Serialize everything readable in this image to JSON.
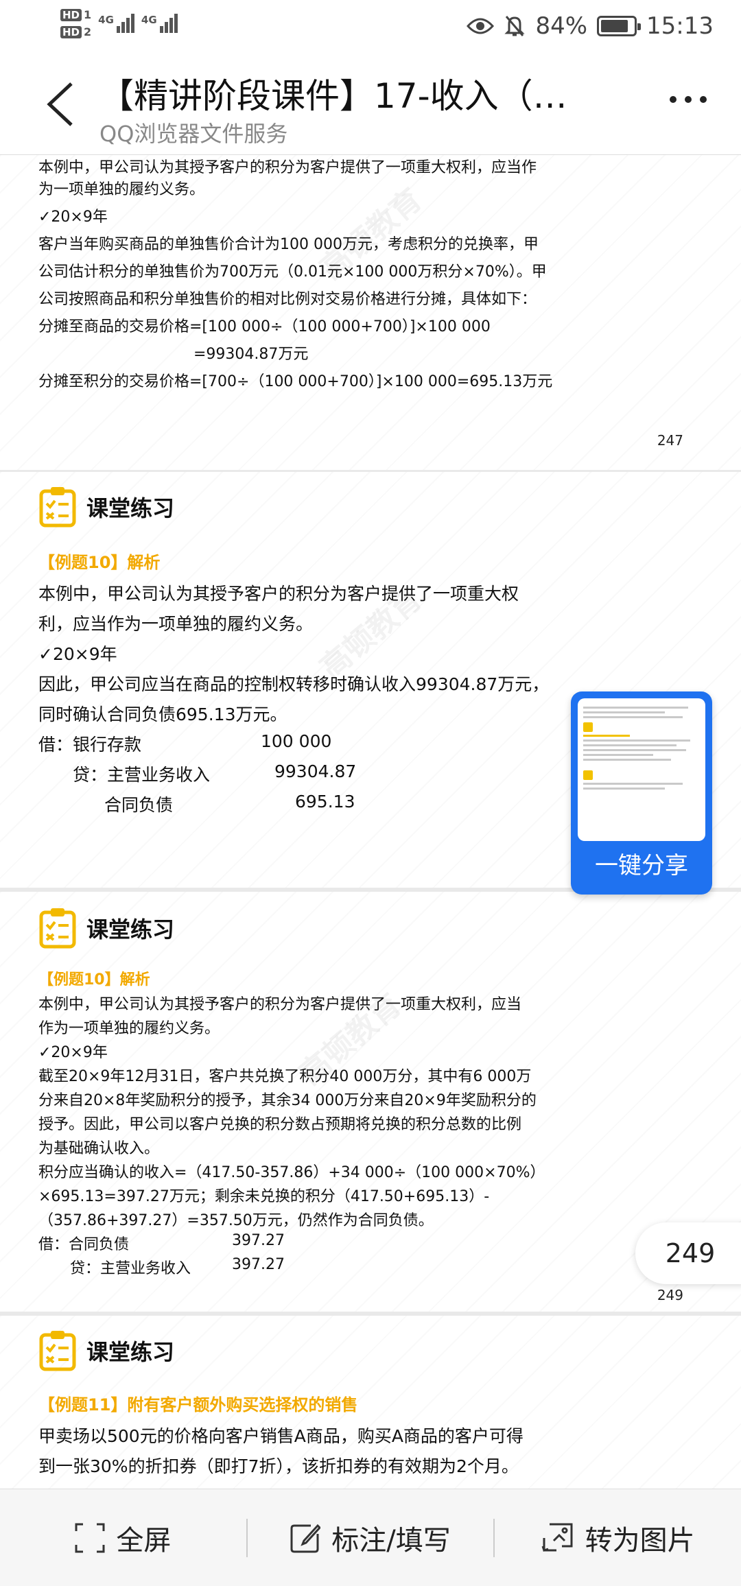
{
  "status_bar": {
    "hd1": "HD",
    "hd1_num": "1",
    "hd2": "HD",
    "hd2_num": "2",
    "net1": "4G",
    "net2": "4G",
    "battery_pct": "84%",
    "battery_level": 0.84,
    "time": "15:13"
  },
  "header": {
    "title": "【精讲阶段课件】17-收入（…",
    "subtitle": "QQ浏览器文件服务"
  },
  "pages": {
    "p247": {
      "lines": [
        "本例中，甲公司认为其授予客户的积分为客户提供了一项重大权利，应当作",
        "为一项单独的履约义务。",
        "✓20×9年",
        "客户当年购买商品的单独售价合计为100 000万元，考虑积分的兑换率，甲",
        "公司估计积分的单独售价为700万元（0.01元×100 000万积分×70%）。甲",
        "公司按照商品和积分单独售价的相对比例对交易价格进行分摊，具体如下：",
        "分摊至商品的交易价格=[100 000÷（100 000+700）]×100 000",
        "=99304.87万元",
        "分摊至积分的交易价格=[700÷（100 000+700）]×100 000=695.13万元"
      ],
      "page_number": "247"
    },
    "p248": {
      "heading": "课堂练习",
      "section": "【例题10】解析",
      "lines": [
        "本例中，甲公司认为其授予客户的积分为客户提供了一项重大权",
        "利，应当作为一项单独的履约义务。",
        "✓20×9年",
        "因此，甲公司应当在商品的控制权转移时确认收入99304.87万元，",
        "同时确认合同负债695.13万元。"
      ],
      "entries": [
        {
          "label": "借：银行存款",
          "amount": "100 000"
        },
        {
          "label": "贷：主营业务收入",
          "amount": "99304.87"
        },
        {
          "label": "合同负债",
          "amount": "695.13"
        }
      ],
      "watermark": "高顿教育"
    },
    "p249": {
      "heading": "课堂练习",
      "section": "【例题10】解析",
      "lines": [
        "本例中，甲公司认为其授予客户的积分为客户提供了一项重大权利，应当",
        "作为一项单独的履约义务。",
        "✓20×9年",
        "截至20×9年12月31日，客户共兑换了积分40 000万分，其中有6 000万",
        "分来自20×8年奖励积分的授予，其余34 000万分来自20×9年奖励积分的",
        "授予。因此，甲公司以客户兑换的积分数占预期将兑换的积分总数的比例",
        "为基础确认收入。",
        "积分应当确认的收入=（417.50-357.86）+34 000÷（100 000×70%）",
        "×695.13=397.27万元；剩余未兑换的积分（417.50+695.13）-",
        "（357.86+397.27）=357.50万元，仍然作为合同负债。"
      ],
      "entries": [
        {
          "label": "借：合同负债",
          "amount": "397.27"
        },
        {
          "label": "贷：主营业务收入",
          "amount": "397.27"
        }
      ],
      "page_number": "249",
      "watermark": "高顿教育"
    },
    "p250": {
      "heading": "课堂练习",
      "section": "【例题11】附有客户额外购买选择权的销售",
      "lines": [
        "甲卖场以500元的价格向客户销售A商品，购买A商品的客户可得",
        "到一张30%的折扣券（即打7折），该折扣券的有效期为2个月。"
      ]
    }
  },
  "share_card": {
    "label": "一键分享"
  },
  "page_badge": "249",
  "bottom_bar": {
    "fullscreen": "全屏",
    "annotate": "标注/填写",
    "to_image": "转为图片"
  }
}
